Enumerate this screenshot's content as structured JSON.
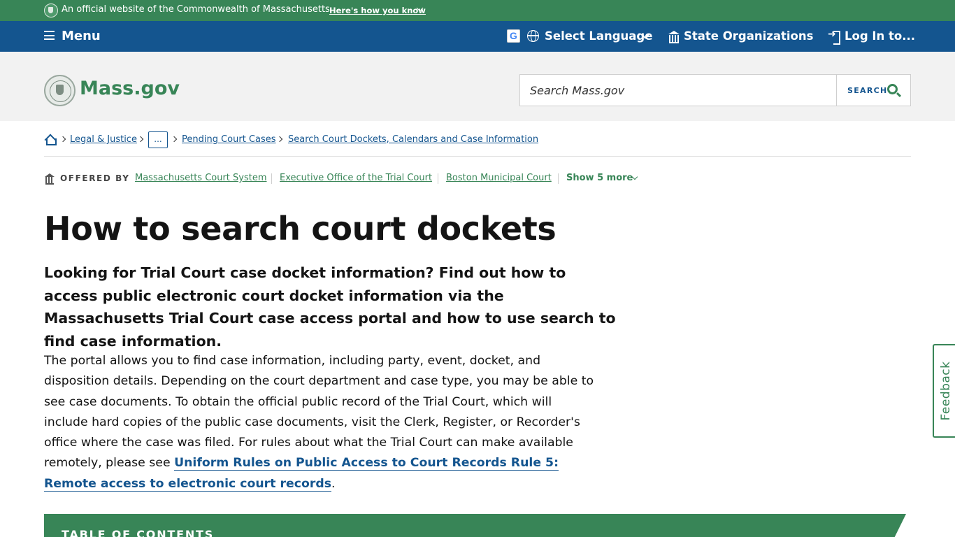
{
  "official_banner": {
    "text": "An official website of the Commonwealth of Massachusetts",
    "how_link": "Here's how you know"
  },
  "utility_nav": {
    "menu_label": "Menu",
    "language_label": "Select Language",
    "google_icon_letter": "G",
    "orgs_label": "State Organizations",
    "login_label": "Log In to..."
  },
  "header": {
    "logo_text": "Mass.gov",
    "search": {
      "placeholder": "Search Mass.gov",
      "button_label": "SEARCH"
    }
  },
  "breadcrumbs": {
    "items": [
      "Legal & Justice",
      "...",
      "Pending Court Cases",
      "Search Court Dockets, Calendars and Case Information"
    ]
  },
  "offered_by": {
    "label": "OFFERED BY",
    "orgs": [
      "Massachusetts Court System",
      "Executive Office of the Trial Court",
      "Boston Municipal Court"
    ],
    "show_more": "Show 5 more"
  },
  "content": {
    "title": "How to search court dockets",
    "lede": "Looking for Trial Court case docket information? Find out how to access public electronic court docket information via the Massachusetts Trial Court case access portal and how to use search to find case information.",
    "body_before_link": "The portal allows you to find case information, including party, event, docket, and disposition details. Depending on the court department and case type, you may be able to see case documents. To obtain the official public record of the Trial Court, which will include hard copies of the public case documents, visit the Clerk, Register, or Recorder's office where the case was filed. For rules about what the Trial Court can make available remotely, please see ",
    "body_link": "Uniform Rules on Public Access to Court Records Rule 5: Remote access to electronic court records",
    "body_after_link": "."
  },
  "toc": {
    "title": "TABLE OF CONTENTS"
  },
  "feedback": {
    "label": "Feedback"
  },
  "colors": {
    "green": "#388557",
    "blue": "#14558f",
    "header_gray": "#f2f2f2"
  },
  "icons": {
    "banner": "state-seal-icon",
    "banner_chevron": "chevron-down-icon",
    "menu": "hamburger-icon",
    "translate": "google-translate-icon",
    "language": "globe-icon",
    "language_chevron": "chevron-down-icon",
    "orgs": "building-icon",
    "login": "login-icon",
    "logo": "state-seal-icon",
    "search": "search-icon",
    "breadcrumb_home": "home-icon",
    "breadcrumb_separator": "chevron-right-icon",
    "offered_by": "building-icon",
    "show_more": "chevron-down-icon"
  }
}
